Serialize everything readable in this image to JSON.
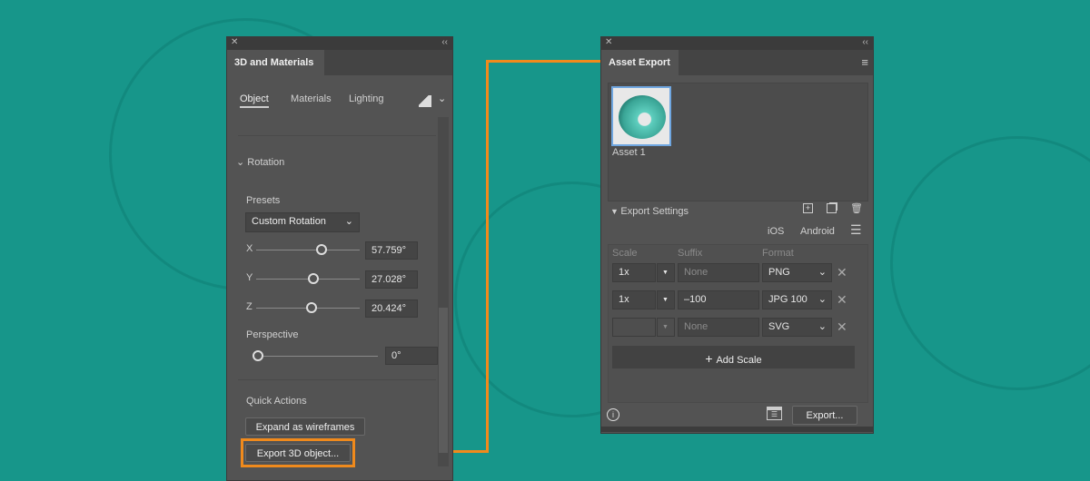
{
  "left_panel": {
    "title": "3D and Materials",
    "tabs": [
      {
        "label": "Object"
      },
      {
        "label": "Materials"
      },
      {
        "label": "Lighting"
      }
    ],
    "section": "Rotation",
    "presets_label": "Presets",
    "preset_value": "Custom Rotation",
    "axes": [
      {
        "label": "X",
        "value": "57.759°",
        "pos": 0.7
      },
      {
        "label": "Y",
        "value": "27.028°",
        "pos": 0.6
      },
      {
        "label": "Z",
        "value": "20.424°",
        "pos": 0.57
      }
    ],
    "perspective_label": "Perspective",
    "perspective_value": "0°",
    "quick_actions_label": "Quick Actions",
    "expand_button": "Expand as wireframes",
    "export_button": "Export 3D object..."
  },
  "right_panel": {
    "title": "Asset Export",
    "asset_name": "Asset 1",
    "export_settings": "Export Settings",
    "ios": "iOS",
    "android": "Android",
    "columns": {
      "scale": "Scale",
      "suffix": "Suffix",
      "format": "Format"
    },
    "rows": [
      {
        "scale": "1x",
        "suffix": "",
        "suffix_placeholder": "None",
        "format": "PNG"
      },
      {
        "scale": "1x",
        "suffix": "–100",
        "suffix_placeholder": "",
        "format": "JPG 100"
      },
      {
        "scale": "",
        "suffix": "",
        "suffix_placeholder": "None",
        "format": "SVG"
      }
    ],
    "add_scale": "Add Scale",
    "export_button": "Export..."
  },
  "colors": {
    "accent": "#f08a1c",
    "background": "#17968a"
  }
}
